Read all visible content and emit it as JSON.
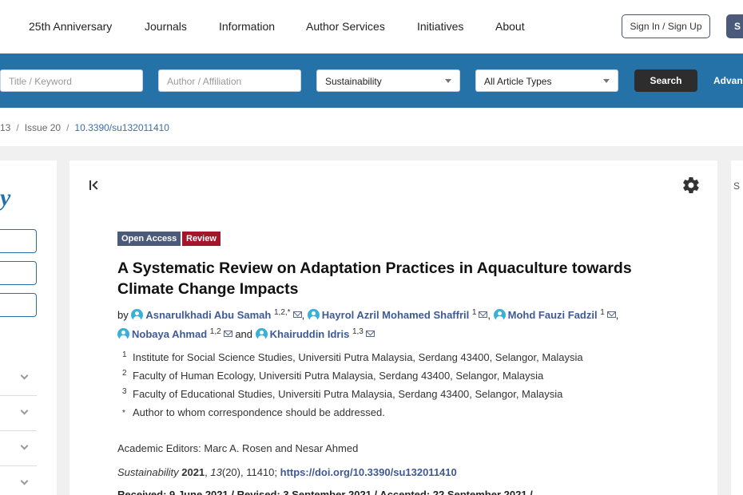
{
  "nav": {
    "items": [
      "25th Anniversary",
      "Journals",
      "Information",
      "Author Services",
      "Initiatives",
      "About"
    ],
    "signin_label": "Sign In / Sign Up",
    "submit_fragment": "S"
  },
  "search": {
    "title_placeholder": "Title / Keyword",
    "author_placeholder": "Author / Affiliation",
    "journal_value": "Sustainability",
    "type_value": "All Article Types",
    "search_label": "Search",
    "advanced_label": "Advan"
  },
  "breadcrumb": {
    "volume": "13",
    "issue": "Issue 20",
    "doi": "10.3390/su132011410"
  },
  "sidebar": {
    "logo_fragment": "y"
  },
  "article": {
    "badges": {
      "open_access": "Open Access",
      "type": "Review"
    },
    "title": "A Systematic Review on Adaptation Practices in Aquaculture towards Climate Change Impacts",
    "by_label": "by",
    "and_label": "and",
    "authors": [
      {
        "name": "Asnarulkhadi Abu Samah",
        "sup": "1,2,*"
      },
      {
        "name": "Hayrol Azril Mohamed Shaffril",
        "sup": "1"
      },
      {
        "name": "Mohd Fauzi Fadzil",
        "sup": "1"
      },
      {
        "name": "Nobaya Ahmad",
        "sup": "1,2"
      },
      {
        "name": "Khairuddin Idris",
        "sup": "1,3"
      }
    ],
    "affiliations": [
      {
        "num": "1",
        "text": "Institute for Social Science Studies, Universiti Putra Malaysia, Serdang 43400, Selangor, Malaysia"
      },
      {
        "num": "2",
        "text": "Faculty of Human Ecology, Universiti Putra Malaysia, Serdang 43400, Selangor, Malaysia"
      },
      {
        "num": "3",
        "text": "Faculty of Educational Studies, Universiti Putra Malaysia, Serdang 43400, Selangor, Malaysia"
      },
      {
        "num": "*",
        "text": "Author to whom correspondence should be addressed."
      }
    ],
    "editors": "Academic Editors: Marc A. Rosen and Nesar Ahmed",
    "citation": {
      "journal": "Sustainability",
      "year": "2021",
      "volume": "13",
      "issue_article": "(20), 11410;",
      "doi_link": "https://doi.org/10.3390/su132011410"
    },
    "dates": "Received: 9 June 2021 / Revised: 3 September 2021 / Accepted: 22 September 2021 /"
  },
  "colors": {
    "brand_blue": "#2572a8",
    "badge_open_access": "#4b5a7a",
    "badge_review": "#a4142a",
    "author_link": "#3f5a94"
  },
  "icons": [
    "collapse-left-icon",
    "settings-gear-icon",
    "author-profile-icon",
    "email-icon",
    "chevron-down-icon"
  ]
}
